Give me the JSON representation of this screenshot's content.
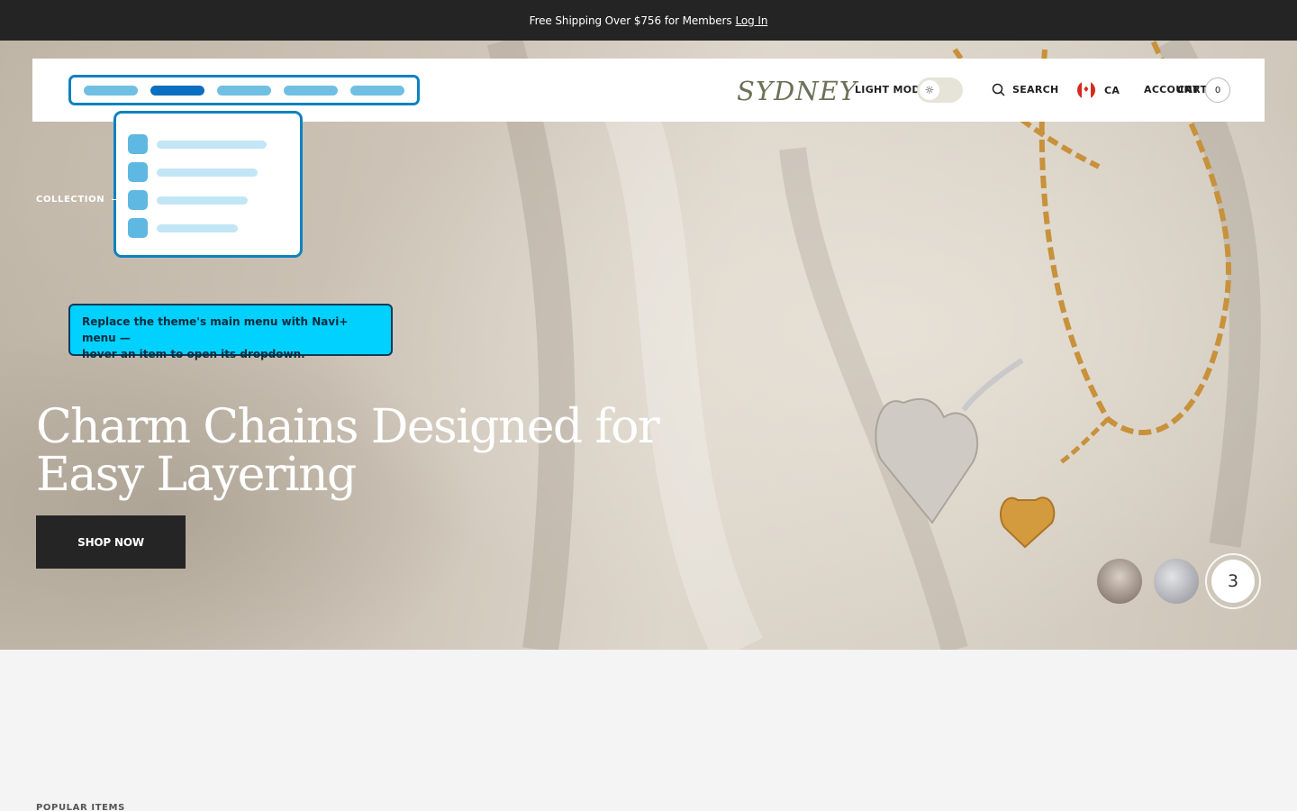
{
  "announcement": {
    "text": "Free Shipping Over $756 for Members",
    "login_label": "Log In"
  },
  "header": {
    "logo": "SYDNEY",
    "light_mode_label": "LIGHT MODE",
    "search_label": "SEARCH",
    "country_code": "CA",
    "account_label": "ACCOUNT",
    "cart_label": "CART",
    "cart_count": "0"
  },
  "hero": {
    "eyebrow": "COLLECTION",
    "headline_line1": "Charm Chains Designed for",
    "headline_line2": "Easy Layering",
    "cta_label": "SHOP NOW",
    "slide_current": "3"
  },
  "tooltip": {
    "line1": "Replace the theme's main menu with Navi+ menu —",
    "line2": "hover an item to open its dropdown."
  },
  "sections": {
    "popular_label": "POPULAR ITEMS"
  },
  "colors": {
    "accent": "#00d1ff",
    "menu_border": "#0e82c0",
    "dark": "#242424",
    "logo": "#6b7257"
  }
}
